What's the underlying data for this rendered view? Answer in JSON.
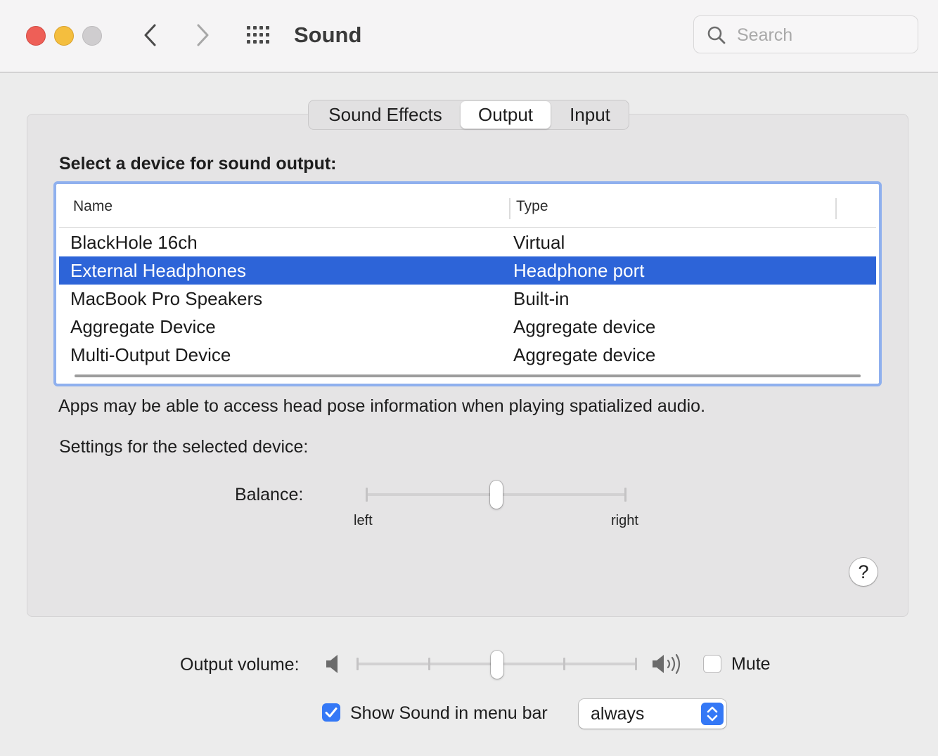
{
  "window": {
    "title": "Sound",
    "search_placeholder": "Search"
  },
  "tabs": [
    {
      "label": "Sound Effects",
      "selected": false
    },
    {
      "label": "Output",
      "selected": true
    },
    {
      "label": "Input",
      "selected": false
    }
  ],
  "output": {
    "section_label": "Select a device for sound output:",
    "columns": {
      "name": "Name",
      "type": "Type"
    },
    "devices": [
      {
        "name": "BlackHole 16ch",
        "type": "Virtual",
        "selected": false
      },
      {
        "name": "External Headphones",
        "type": "Headphone port",
        "selected": true
      },
      {
        "name": "MacBook Pro Speakers",
        "type": "Built-in",
        "selected": false
      },
      {
        "name": "Aggregate Device",
        "type": "Aggregate device",
        "selected": false
      },
      {
        "name": "Multi-Output Device",
        "type": "Aggregate device",
        "selected": false
      }
    ],
    "info_text": "Apps may be able to access head pose information when playing spatialized audio.",
    "settings_label": "Settings for the selected device:",
    "balance": {
      "label": "Balance:",
      "left_label": "left",
      "right_label": "right",
      "value": 0.5
    },
    "help_label": "?"
  },
  "volume": {
    "label": "Output volume:",
    "value": 0.5,
    "mute_label": "Mute",
    "mute_checked": false
  },
  "menubar": {
    "label": "Show Sound in menu bar",
    "checked": true,
    "option": "always"
  },
  "colors": {
    "selection": "#2d64d8",
    "accent": "#3478f6",
    "table_focus_ring": "#8fb0ee",
    "close": "#ee5f57",
    "minimize": "#f4be3e"
  },
  "icons": {
    "close": "close-button",
    "minimize": "minimize-button",
    "zoom": "zoom-button",
    "back": "chevron-left-icon",
    "forward": "chevron-right-icon",
    "show_all": "grid-icon",
    "search": "search-icon",
    "volume_low": "speaker-low-icon",
    "volume_high": "speaker-high-icon",
    "checkmark": "checkmark-icon",
    "popup": "updown-arrows-icon"
  }
}
